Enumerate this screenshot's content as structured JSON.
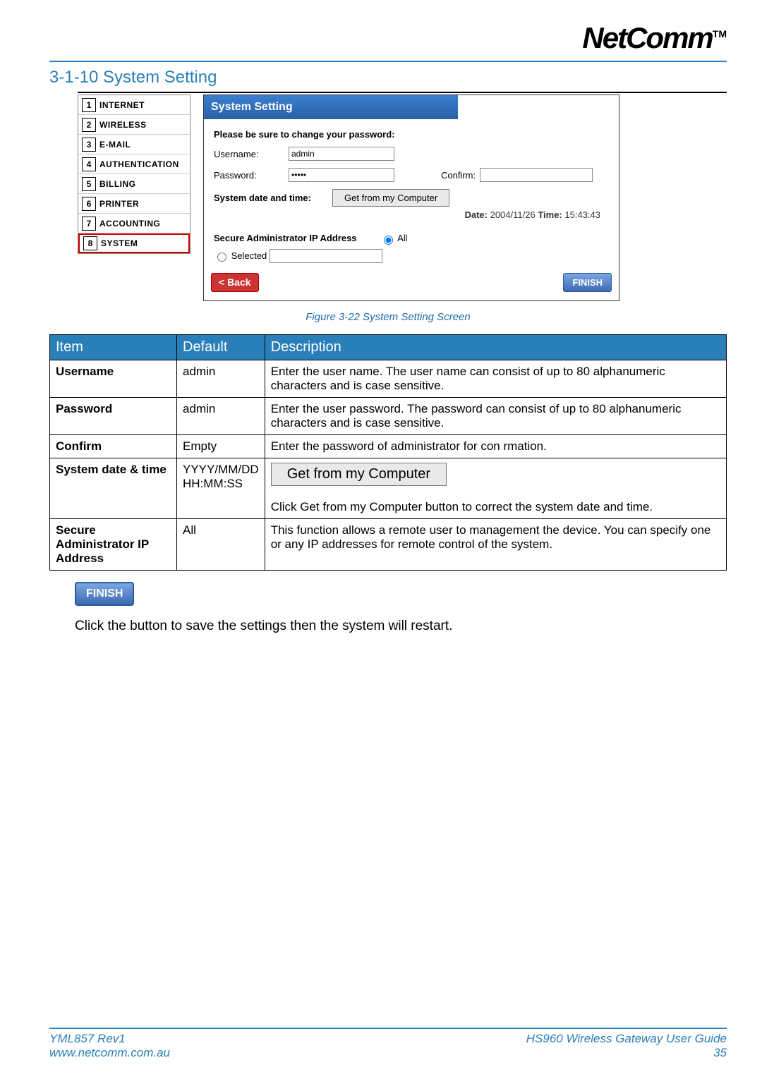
{
  "brand": "NetComm",
  "tm": "TM",
  "section_title": "3-1-10   System Setting",
  "sidebar": {
    "items": [
      {
        "num": "1",
        "label": "INTERNET"
      },
      {
        "num": "2",
        "label": "WIRELESS"
      },
      {
        "num": "3",
        "label": "E-MAIL"
      },
      {
        "num": "4",
        "label": "AUTHENTICATION"
      },
      {
        "num": "5",
        "label": "BILLING"
      },
      {
        "num": "6",
        "label": "PRINTER"
      },
      {
        "num": "7",
        "label": "ACCOUNTING"
      },
      {
        "num": "8",
        "label": "SYSTEM"
      }
    ],
    "active_index": 7
  },
  "panel": {
    "title": "System Setting",
    "prompt": "Please be sure to change your password:",
    "username_label": "Username:",
    "username_value": "admin",
    "password_label": "Password:",
    "password_value": "*****",
    "confirm_label": "Confirm:",
    "confirm_value": "",
    "datetime_label": "System date and time:",
    "get_button": "Get from my Computer",
    "date_label": "Date:",
    "date_value": "2004/11/26",
    "time_label": "Time:",
    "time_value": "15:43:43",
    "secure_label": "Secure Administrator IP Address",
    "radio_all": "All",
    "radio_selected": "Selected",
    "back": "< Back",
    "finish": "FINISH"
  },
  "caption": "Figure 3-22 System Setting Screen",
  "table": {
    "headers": [
      "Item",
      "Default",
      "Description"
    ],
    "rows": [
      {
        "item": "Username",
        "default": "admin",
        "desc": "Enter the user name. The user name can consist of up to 80 alphanumeric characters and is case sensitive."
      },
      {
        "item": "Password",
        "default": "admin",
        "desc": "Enter the user password. The password can consist of up to 80 alphanumeric characters and is case sensitive."
      },
      {
        "item": "Confirm",
        "default": "Empty",
        "desc": "Enter the password of administrator for con rmation."
      },
      {
        "item": "System date & time",
        "default": "YYYY/MM/DD HH:MM:SS",
        "desc_button": "Get from my Computer",
        "desc_tail": "Click Get from my Computer button to correct the system date and time."
      },
      {
        "item": "Secure Administrator IP Address",
        "default": "All",
        "desc": "This function allows a remote user to management the device. You can specify one or any IP addresses for remote control of the system."
      }
    ]
  },
  "finish_label": "FINISH",
  "body_text": "Click the button to save the settings then the system will restart.",
  "footer": {
    "left_top": "YML857 Rev1",
    "left_bottom": "www.netcomm.com.au",
    "right_top": "HS960 Wireless Gateway User Guide",
    "right_bottom": "35"
  }
}
